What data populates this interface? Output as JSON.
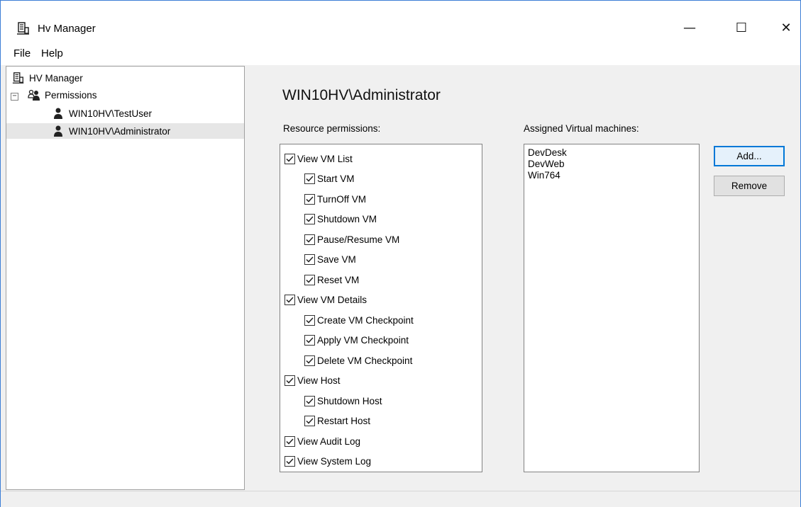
{
  "window": {
    "title": "Hv Manager",
    "min_glyph": "—",
    "max_glyph": "☐",
    "close_glyph": "✕"
  },
  "menu": {
    "file": "File",
    "help": "Help"
  },
  "tree": {
    "root": "HV Manager",
    "expander": "−",
    "permissions": "Permissions",
    "users": [
      "WIN10HV\\TestUser",
      "WIN10HV\\Administrator"
    ],
    "selected_index": 1
  },
  "main": {
    "title": "WIN10HV\\Administrator",
    "resource_label": "Resource permissions:",
    "assigned_label": "Assigned Virtual machines:",
    "permissions": [
      {
        "label": "View VM List",
        "checked": true,
        "level": 0
      },
      {
        "label": "Start VM",
        "checked": true,
        "level": 1
      },
      {
        "label": "TurnOff VM",
        "checked": true,
        "level": 1
      },
      {
        "label": "Shutdown VM",
        "checked": true,
        "level": 1
      },
      {
        "label": "Pause/Resume VM",
        "checked": true,
        "level": 1
      },
      {
        "label": "Save VM",
        "checked": true,
        "level": 1
      },
      {
        "label": "Reset VM",
        "checked": true,
        "level": 1
      },
      {
        "label": "View VM Details",
        "checked": true,
        "level": 0
      },
      {
        "label": "Create VM Checkpoint",
        "checked": true,
        "level": 1
      },
      {
        "label": "Apply VM Checkpoint",
        "checked": true,
        "level": 1
      },
      {
        "label": "Delete VM Checkpoint",
        "checked": true,
        "level": 1
      },
      {
        "label": "View Host",
        "checked": true,
        "level": 0
      },
      {
        "label": "Shutdown Host",
        "checked": true,
        "level": 1
      },
      {
        "label": "Restart Host",
        "checked": true,
        "level": 1
      },
      {
        "label": "View Audit Log",
        "checked": true,
        "level": 0
      },
      {
        "label": "View System Log",
        "checked": true,
        "level": 0
      }
    ],
    "vms": [
      "DevDesk",
      "DevWeb",
      "Win764"
    ],
    "add_button": "Add...",
    "remove_button": "Remove"
  },
  "colors": {
    "accent": "#0078d7",
    "selection": "#e6e6e6",
    "window_bg": "#f0f0f0"
  }
}
